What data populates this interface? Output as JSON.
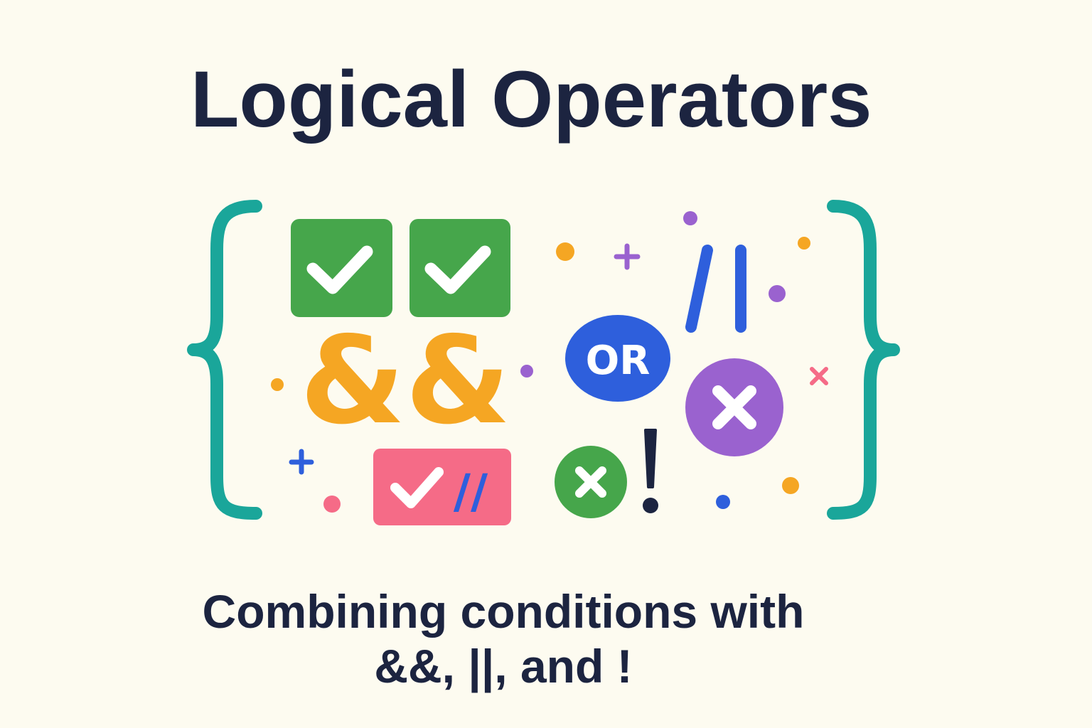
{
  "header": {
    "title": "Logical Operators"
  },
  "footer": {
    "line1": "Combining conditions with",
    "line2": "&&, ||, and !"
  },
  "symbols": {
    "and_operator": "&&",
    "or_word": "OR",
    "or_operator": "//",
    "not_operator": "!",
    "pink_badge_operator": "//"
  },
  "icons": {
    "left_brace": "curly-brace-left-icon",
    "right_brace": "curly-brace-right-icon",
    "check_box": "check-box-icon",
    "cross_circle": "cross-circle-icon",
    "plus": "plus-sparkle-icon",
    "dot": "confetti-dot-icon"
  },
  "colors": {
    "background": "#fdfbf0",
    "text": "#1c2440",
    "teal": "#1aa69a",
    "green": "#46a64b",
    "orange": "#f5a623",
    "blue": "#2e5fdc",
    "purple": "#9a62cf",
    "pink": "#f56b87",
    "dark": "#1c2440"
  }
}
